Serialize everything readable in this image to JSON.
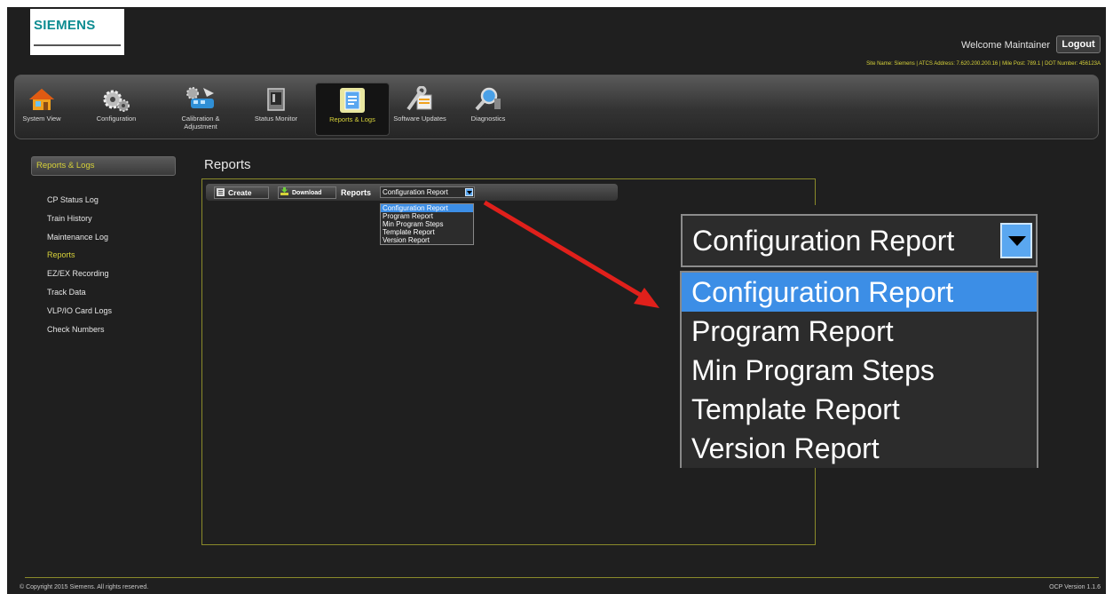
{
  "header": {
    "logo": "SIEMENS",
    "welcome": "Welcome Maintainer",
    "logout_label": "Logout",
    "site_info": "Site Name: Siemens | ATCS Address: 7.620.200.200.16 | Mile Post: 789.1 | DOT Number: 456123A"
  },
  "toolbar": {
    "items": [
      {
        "label": "System View",
        "icon": "house-icon"
      },
      {
        "label": "Configuration",
        "icon": "gears-icon"
      },
      {
        "label": "Calibration & Adjustment",
        "icon": "calibration-icon"
      },
      {
        "label": "Status Monitor",
        "icon": "monitor-icon"
      },
      {
        "label": "Reports & Logs",
        "icon": "document-icon",
        "active": true
      },
      {
        "label": "Software Updates",
        "icon": "wrench-icon"
      },
      {
        "label": "Diagnostics",
        "icon": "magnifier-icon"
      }
    ]
  },
  "sidebar": {
    "title": "Reports & Logs",
    "items": [
      {
        "label": "CP Status Log"
      },
      {
        "label": "Train History"
      },
      {
        "label": "Maintenance Log"
      },
      {
        "label": "Reports",
        "active": true
      },
      {
        "label": "EZ/EX Recording"
      },
      {
        "label": "Track Data"
      },
      {
        "label": "VLP/IO Card Logs"
      },
      {
        "label": "Check Numbers"
      }
    ]
  },
  "main": {
    "title": "Reports",
    "create_label": "Create",
    "download_label": "Download",
    "reports_label": "Reports",
    "selected_report": "Configuration Report",
    "options": [
      "Configuration Report",
      "Program Report",
      "Min Program Steps",
      "Template Report",
      "Version Report"
    ]
  },
  "footer": {
    "copyright": "© Copyright 2015 Siemens. All rights reserved.",
    "version": "OCP Version 1.1.6"
  },
  "colors": {
    "accent_yellow": "#d7d23a",
    "selection_blue": "#3c8ee6",
    "arrow_red": "#e0201b",
    "logo_teal": "#0d8c91"
  }
}
